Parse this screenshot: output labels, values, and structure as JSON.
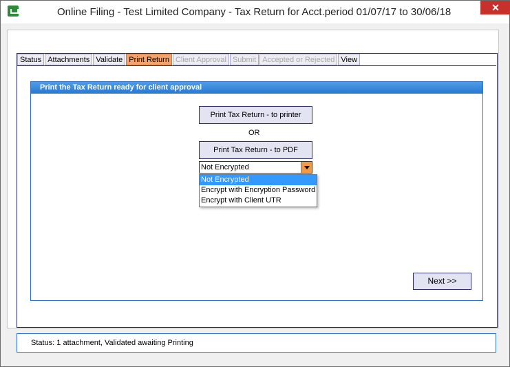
{
  "window": {
    "title": "Online Filing - Test Limited Company - Tax Return for Acct.period 01/07/17 to 30/06/18",
    "close_label": "✕"
  },
  "tabs": [
    {
      "label": "Status",
      "state": "normal"
    },
    {
      "label": "Attachments",
      "state": "normal"
    },
    {
      "label": "Validate",
      "state": "normal"
    },
    {
      "label": "Print Return",
      "state": "active"
    },
    {
      "label": "Client Approval",
      "state": "disabled"
    },
    {
      "label": "Submit",
      "state": "disabled"
    },
    {
      "label": "Accepted or Rejected",
      "state": "disabled"
    },
    {
      "label": "View",
      "state": "normal"
    }
  ],
  "panel": {
    "header": "Print the Tax Return ready for client approval",
    "print_printer_label": "Print Tax Return - to printer",
    "or_label": "OR",
    "print_pdf_label": "Print Tax Return - to PDF",
    "encryption": {
      "selected": "Not Encrypted",
      "options": [
        "Not Encrypted",
        "Encrypt with Encryption Password",
        "Encrypt with Client UTR"
      ]
    },
    "next_label": "Next >>"
  },
  "status": {
    "text": "Status: 1 attachment, Validated awaiting Printing"
  },
  "colors": {
    "active_tab": "#f5a36a",
    "header_blue": "#2a78d0",
    "selected_item": "#3399ff",
    "close_red": "#c7302b"
  }
}
